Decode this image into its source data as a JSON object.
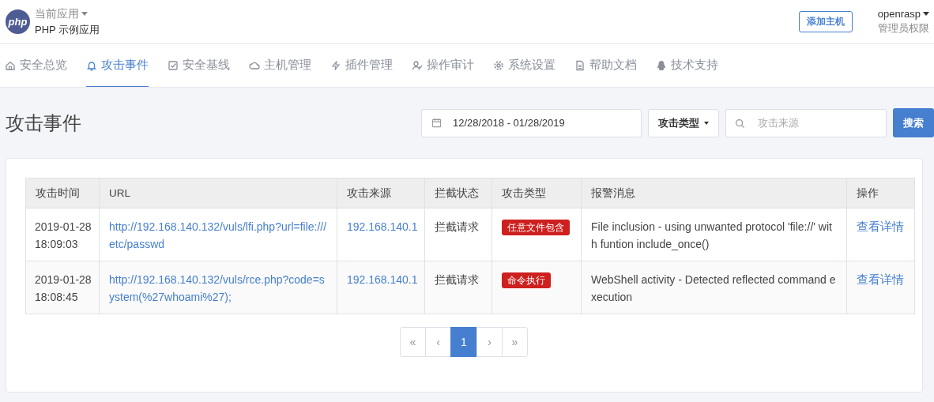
{
  "header": {
    "logo_text": "php",
    "app_switcher": "当前应用",
    "app_name": "PHP 示例应用",
    "add_host_button": "添加主机",
    "user": {
      "name": "openrasp",
      "role": "管理员权限"
    }
  },
  "nav": [
    {
      "kind": "home",
      "label": "安全总览",
      "selected": false
    },
    {
      "kind": "bell",
      "label": "攻击事件",
      "selected": true
    },
    {
      "kind": "check",
      "label": "安全基线",
      "selected": false
    },
    {
      "kind": "cloud",
      "label": "主机管理",
      "selected": false
    },
    {
      "kind": "bolt",
      "label": "插件管理",
      "selected": false
    },
    {
      "kind": "user",
      "label": "操作审计",
      "selected": false
    },
    {
      "kind": "gear",
      "label": "系统设置",
      "selected": false
    },
    {
      "kind": "doc",
      "label": "帮助文档",
      "selected": false
    },
    {
      "kind": "penguin",
      "label": "技术支持",
      "selected": false
    }
  ],
  "page_title": "攻击事件",
  "filters": {
    "date_range": "12/28/2018 - 01/28/2019",
    "type_dropdown": "攻击类型",
    "source_search": {
      "placeholder": "攻击来源"
    },
    "search_button": "搜索"
  },
  "table": {
    "columns": [
      "攻击时间",
      "URL",
      "攻击来源",
      "拦截状态",
      "攻击类型",
      "报警消息",
      "操作"
    ],
    "rows": [
      {
        "time": "2019-01-28 18:09:03",
        "url": "http://192.168.140.132/vuls/lfi.php?url=file:///etc/passwd",
        "source": "192.168.140.1",
        "status": "拦截请求",
        "type": "任意文件包含",
        "message": "File inclusion - using unwanted protocol 'file://' with funtion include_once()",
        "action": "查看详情"
      },
      {
        "time": "2019-01-28 18:08:45",
        "url": "http://192.168.140.132/vuls/rce.php?code=system(%27whoami%27);",
        "source": "192.168.140.1",
        "status": "拦截请求",
        "type": "命令执行",
        "message": "WebShell activity - Detected reflected command execution",
        "action": "查看详情"
      }
    ]
  },
  "pagination": [
    {
      "label": "«",
      "selected": false,
      "disabled": true
    },
    {
      "label": "‹",
      "selected": false,
      "disabled": true
    },
    {
      "label": "1",
      "selected": true,
      "disabled": false
    },
    {
      "label": "›",
      "selected": false,
      "disabled": true
    },
    {
      "label": "»",
      "selected": false,
      "disabled": true
    }
  ]
}
